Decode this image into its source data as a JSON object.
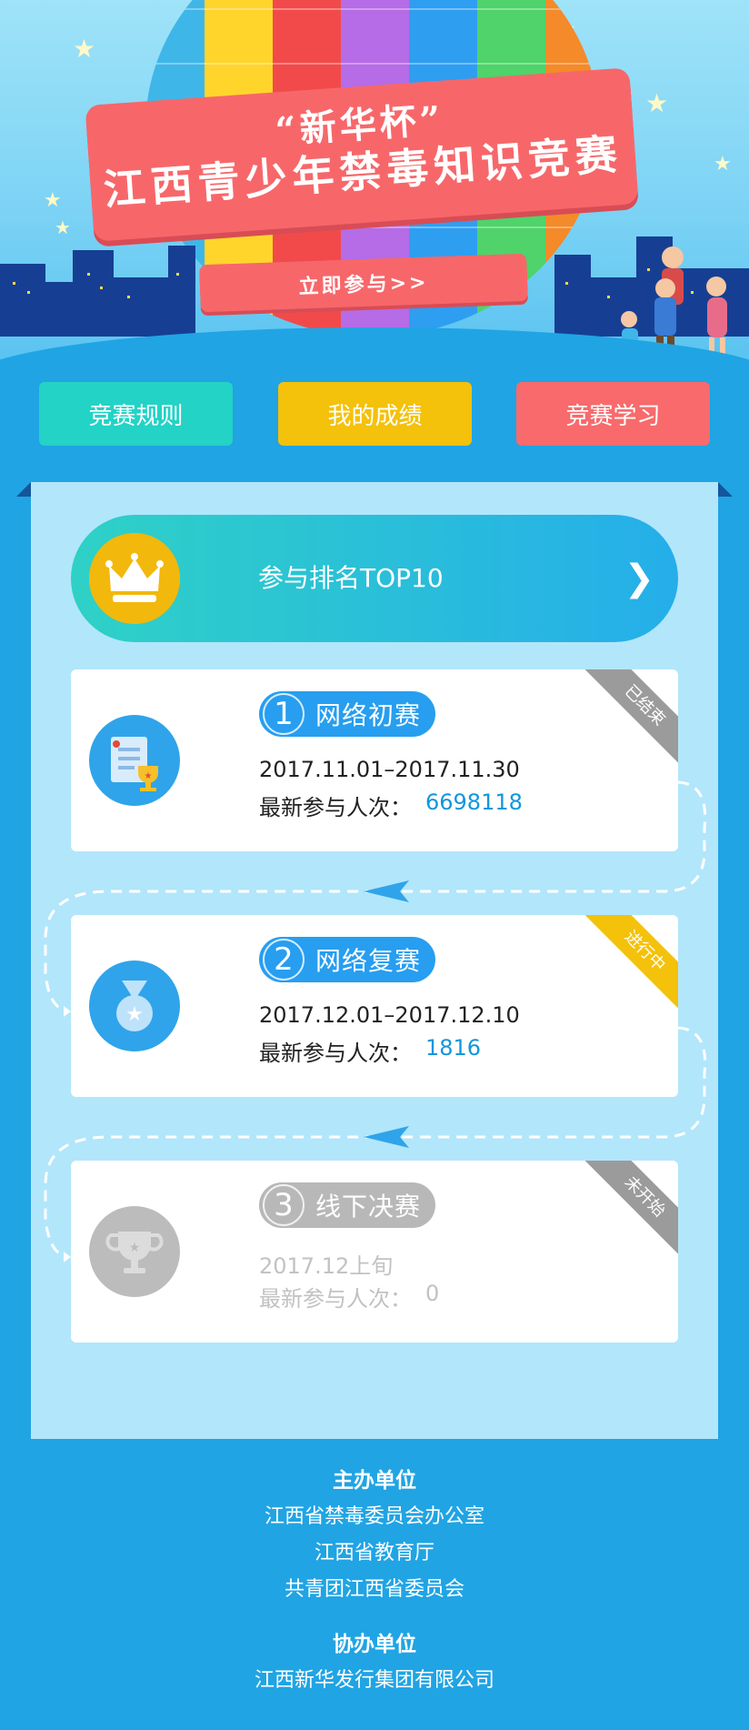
{
  "hero": {
    "banner_line1": "“新华杯”",
    "banner_line2": "江西青少年禁毒知识竞赛",
    "join_link": "立即参与>>"
  },
  "nav": [
    {
      "label": "竞赛规则",
      "color": "#22d3c6"
    },
    {
      "label": "我的成绩",
      "color": "#f4c10b"
    },
    {
      "label": "竞赛学习",
      "color": "#f86a6c"
    }
  ],
  "top10": {
    "label": "参与排名TOP10"
  },
  "stages": [
    {
      "number": "1",
      "name": "网络初赛",
      "date": "2017.11.01–2017.11.30",
      "participants_label": "最新参与人次：",
      "participants": "6698118",
      "status": "已结束",
      "status_color": "#9b9b9b",
      "pill_color": "#279ef0",
      "icon": "certificate-trophy-icon"
    },
    {
      "number": "2",
      "name": "网络复赛",
      "date": "2017.12.01–2017.12.10",
      "participants_label": "最新参与人次：",
      "participants": "1816",
      "status": "进行中",
      "status_color": "#f4c10b",
      "pill_color": "#279ef0",
      "icon": "medal-icon"
    },
    {
      "number": "3",
      "name": "线下决赛",
      "date": "2017.12上旬",
      "participants_label": "最新参与人次：",
      "participants": "0",
      "status": "未开始",
      "status_color": "#9b9b9b",
      "pill_color": "#b8b8b8",
      "icon": "trophy-icon"
    }
  ],
  "footer": {
    "host_title": "主办单位",
    "hosts": [
      "江西省禁毒委员会办公室",
      "江西省教育厅",
      "共青团江西省委员会"
    ],
    "co_title": "协办单位",
    "co": [
      "江西新华发行集团有限公司"
    ]
  }
}
